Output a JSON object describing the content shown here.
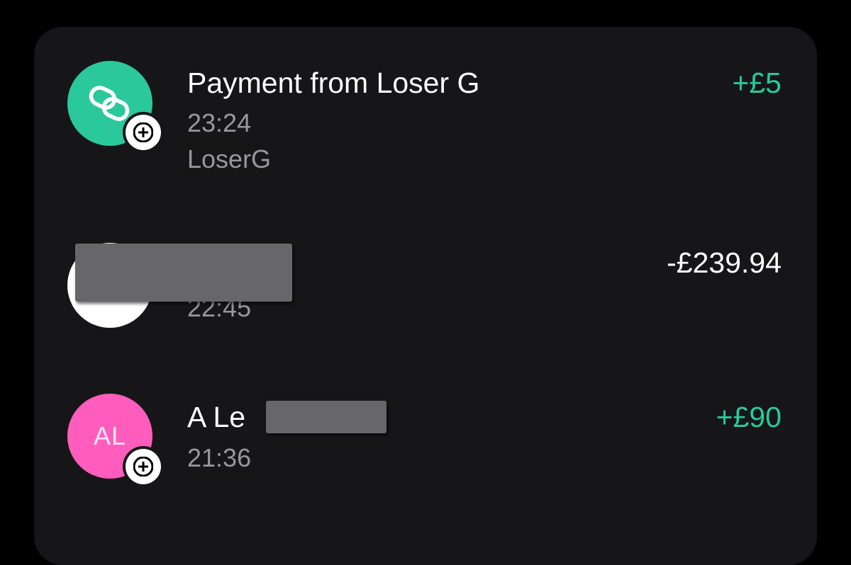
{
  "transactions": [
    {
      "title": "Payment from Loser G",
      "time": "23:24",
      "reference": "LoserG",
      "amount": "+£5",
      "direction": "in",
      "icon": "link-chain-icon",
      "avatar_color": "#2bc89b"
    },
    {
      "title": "",
      "time": "22:45",
      "amount": "-£239.94",
      "direction": "out",
      "avatar_color": "#ffffff",
      "redacted": true
    },
    {
      "title": "A Le",
      "time": "21:36",
      "amount": "+£90",
      "direction": "in",
      "initials": "AL",
      "avatar_color": "#ff5dbd",
      "redacted_name_suffix": true
    }
  ],
  "colors": {
    "positive": "#2bc89b",
    "card_background": "#161618",
    "secondary_text": "#97979d"
  }
}
